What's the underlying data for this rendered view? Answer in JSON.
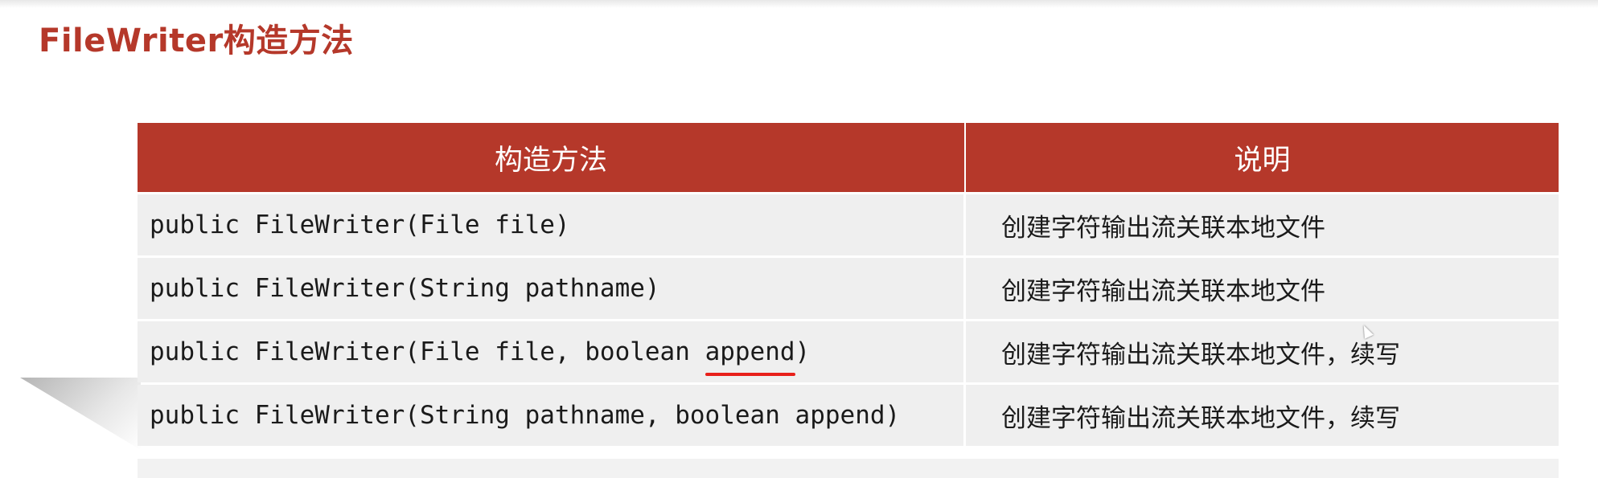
{
  "title": "FileWriter构造方法",
  "table": {
    "headers": [
      "构造方法",
      "说明"
    ],
    "rows": [
      {
        "code": "public FileWriter(File file)",
        "desc": "创建字符输出流关联本地文件"
      },
      {
        "code": "public FileWriter(String pathname)",
        "desc": "创建字符输出流关联本地文件"
      },
      {
        "code_pre": "public FileWriter(File file, boolean ",
        "code_emph": "append",
        "code_post": ")",
        "desc": "创建字符输出流关联本地文件，续写"
      },
      {
        "code": "public FileWriter(String pathname, boolean append)",
        "desc": "创建字符输出流关联本地文件，续写"
      }
    ]
  },
  "colors": {
    "accent": "#b5382a",
    "underline": "#e8201a",
    "row_bg": "#efefef"
  }
}
